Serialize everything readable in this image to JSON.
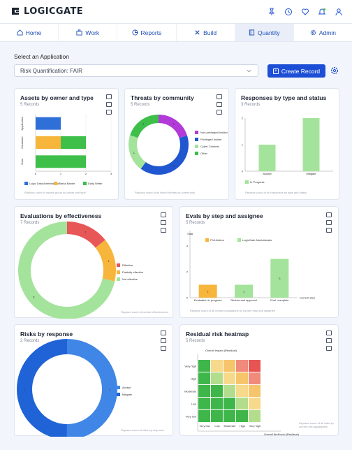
{
  "brand": {
    "name": "LOGICGATE"
  },
  "top_icons": [
    "pin-icon",
    "history-icon",
    "heart-icon",
    "bell-icon",
    "user-icon"
  ],
  "nav": {
    "tabs": [
      {
        "label": "Home",
        "icon": "home-icon"
      },
      {
        "label": "Work",
        "icon": "briefcase-icon"
      },
      {
        "label": "Reports",
        "icon": "pie-chart-icon"
      },
      {
        "label": "Build",
        "icon": "tools-icon"
      },
      {
        "label": "Quantity",
        "icon": "book-icon",
        "active": true
      },
      {
        "label": "Admin",
        "icon": "gear-icon"
      }
    ]
  },
  "app_select": {
    "label": "Select an Application",
    "value": "Risk Quantification: FAIR"
  },
  "create_button": {
    "label": "Create Record"
  },
  "colors": {
    "primary": "#1d4fd6",
    "blue": "#2f6fd8",
    "green": "#3dbf4a",
    "light_green": "#a4e39b",
    "orange": "#f7b53b",
    "purple": "#b23ad8",
    "red": "#e85757"
  },
  "cards": {
    "assets": {
      "title": "Assets by owner and type",
      "records": "5 Records",
      "footer": "Replace count of assets group by owner and type",
      "chart_data": {
        "type": "bar",
        "orientation": "horizontal",
        "stacked": true,
        "categories": [
          "Application",
          "Hardware",
          "Data"
        ],
        "series": [
          {
            "name": "Logic Data Administrator",
            "color": "#2f6fd8",
            "values": [
              1,
              0,
              0
            ]
          },
          {
            "name": "Tasha Baxter",
            "color": "#f7b53b",
            "values": [
              0,
              1,
              0
            ]
          },
          {
            "name": "Daily Writer",
            "color": "#3dbf4a",
            "values": [
              0,
              1,
              2
            ]
          }
        ],
        "xticks": [
          "0",
          "1",
          "2",
          "3"
        ],
        "xlim": [
          0,
          3
        ]
      }
    },
    "threats": {
      "title": "Threats by community",
      "records": "5 Records",
      "footer": "Replace count of all linked threats by community",
      "chart_data": {
        "type": "pie",
        "donut": true,
        "slices": [
          {
            "label": "Non-privileged Insider",
            "value": 1,
            "color": "#b23ad8"
          },
          {
            "label": "Privileged Insider",
            "value": 2,
            "color": "#2056d0"
          },
          {
            "label": "Cyber Criminal",
            "value": 1,
            "color": "#a4e39b"
          },
          {
            "label": "Other",
            "value": 1,
            "color": "#3dbf4a"
          }
        ]
      }
    },
    "responses": {
      "title": "Responses by type and status",
      "records": "3 Records",
      "footer": "Replace count of all responses by type and status",
      "chart_data": {
        "type": "bar",
        "categories": [
          "Accept",
          "Mitigate"
        ],
        "series": [
          {
            "name": "In Progress",
            "color": "#a4e39b",
            "values": [
              1,
              2
            ]
          }
        ],
        "yticks": [
          "0",
          "1",
          "2"
        ],
        "ylim": [
          0,
          2
        ]
      }
    },
    "evaluations": {
      "title": "Evaluations by effectiveness",
      "records": "7 Records",
      "footer": "Replace count of control effectiveness",
      "chart_data": {
        "type": "pie",
        "donut": true,
        "slices": [
          {
            "label": "Effective",
            "value": 1,
            "color": "#e85757"
          },
          {
            "label": "Partially effective",
            "value": 1,
            "color": "#f7b53b"
          },
          {
            "label": "Not effective",
            "value": 5,
            "color": "#a4e39b"
          }
        ]
      }
    },
    "evals_step": {
      "title": "Evals by step and assignee",
      "records": "5 Records",
      "footer": "Replace count of all control evaluations by current step and assignee",
      "chart_data": {
        "type": "bar",
        "stacked": true,
        "categories": [
          "Evaluation in progress",
          "Review and approval",
          "Eval. complete"
        ],
        "series": [
          {
            "name": "Phil Adkins",
            "color": "#f7b53b",
            "values": [
              1,
              0,
              0
            ]
          },
          {
            "name": "LogicGate Administrator",
            "color": "#a4e39b",
            "values": [
              0,
              1,
              3
            ]
          }
        ],
        "ylabel": "Total",
        "xlabel": "Current step",
        "yticks": [
          "0",
          "2",
          "4"
        ],
        "ylim": [
          0,
          4
        ]
      }
    },
    "risks": {
      "title": "Risks by response",
      "records": "2 Records",
      "footer": "Replace count of risks by response",
      "chart_data": {
        "type": "pie",
        "donut": true,
        "slices": [
          {
            "label": "Accept",
            "value": 1,
            "color": "#3f86e6"
          },
          {
            "label": "Mitigate",
            "value": 1,
            "color": "#1f63d6"
          }
        ]
      }
    },
    "heatmap": {
      "title": "Residual risk heatmap",
      "records": "5 Records",
      "footer": "Replace count of all risks by current risk aggregates",
      "chart_data": {
        "type": "heatmap",
        "xlabel": "Overall likelihood (Residual)",
        "ylabel": "Overall impact (Residual)",
        "x_categories": [
          "Very low",
          "Low",
          "Moderate",
          "High",
          "Very high"
        ],
        "y_categories": [
          "Very high",
          "High",
          "Moderate",
          "Low",
          "Very low"
        ],
        "colors": [
          [
            "#3fb64a",
            "#f6d98a",
            "#f6c56b",
            "#f08a7b",
            "#e85454"
          ],
          [
            "#3fb64a",
            "#b2dd8c",
            "#f6d98a",
            "#f6c56b",
            "#f08a7b"
          ],
          [
            "#3fb64a",
            "#3fb64a",
            "#b2dd8c",
            "#f6d98a",
            "#f6c56b"
          ],
          [
            "#3fb64a",
            "#3fb64a",
            "#3fb64a",
            "#b2dd8c",
            "#f6d98a"
          ],
          [
            "#3fb64a",
            "#3fb64a",
            "#3fb64a",
            "#3fb64a",
            "#b2dd8c"
          ]
        ]
      }
    }
  }
}
